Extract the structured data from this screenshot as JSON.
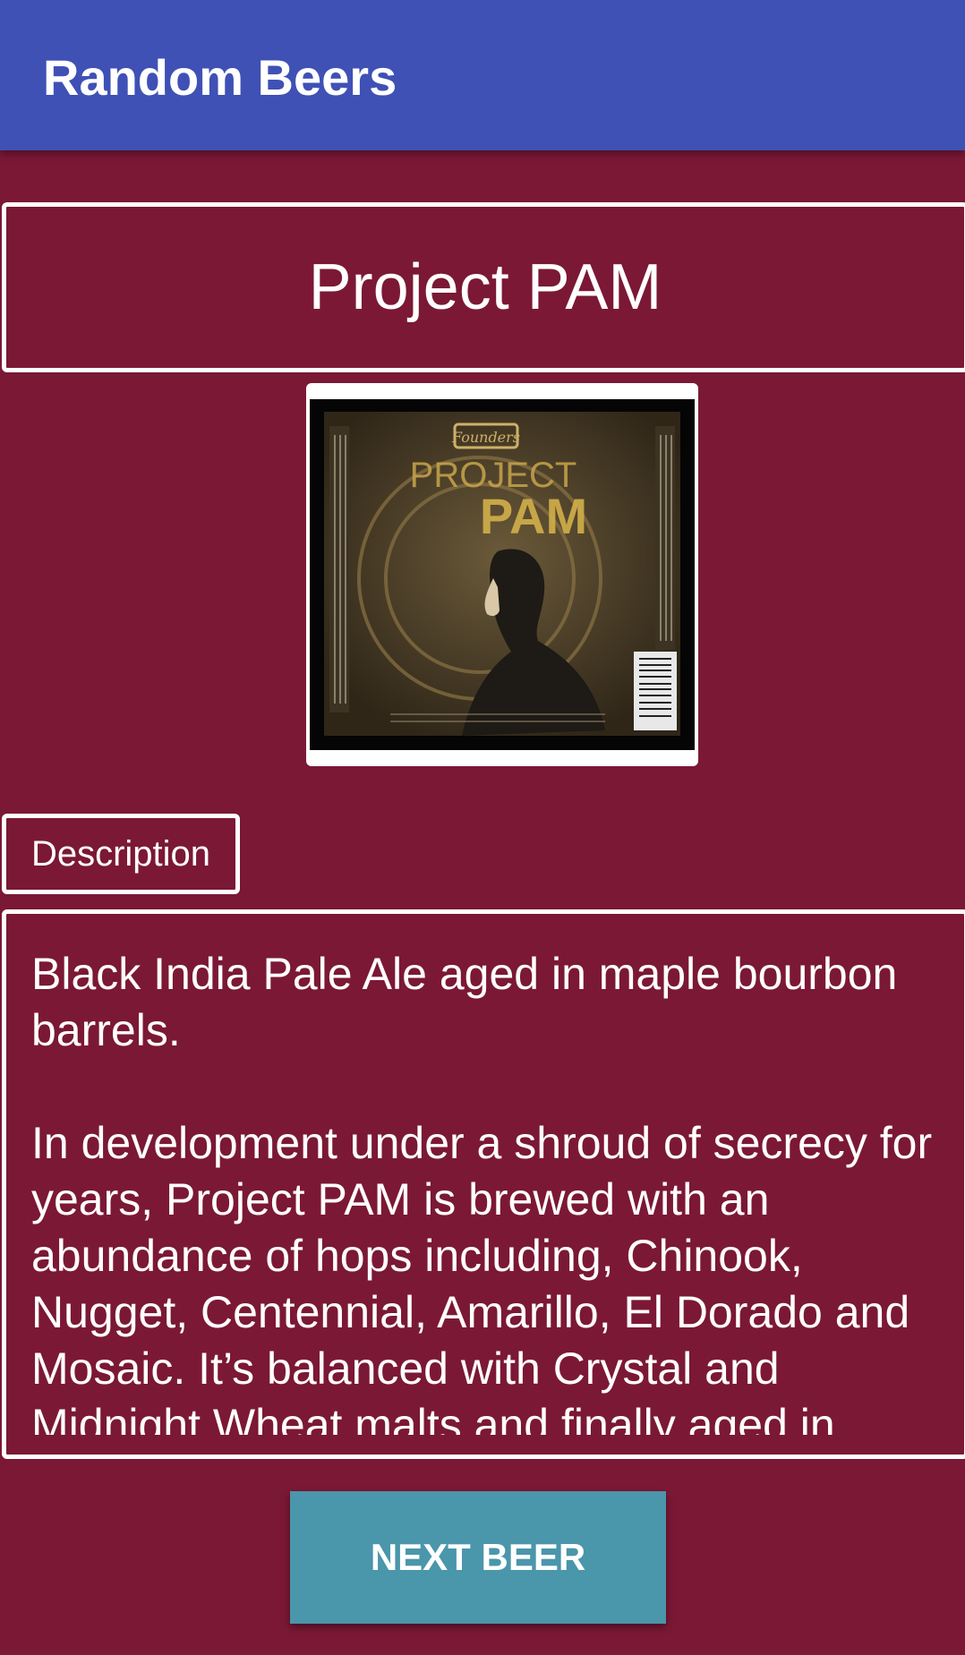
{
  "app_bar": {
    "title": "Random Beers",
    "color": "#3f51b5"
  },
  "theme": {
    "background": "#7b1835",
    "button_color": "#4a96ab"
  },
  "beer": {
    "name": "Project PAM",
    "image": {
      "label_lines": [
        "PROJECT",
        "PAM"
      ],
      "brand_mark": "Founders"
    }
  },
  "description": {
    "label": "Description",
    "text": "Black India Pale Ale aged in maple bourbon barrels.\n\nIn development under a shroud of secrecy for years, Project PAM is brewed with an abundance of hops including, Chinook, Nugget, Centennial, Amarillo, El Dorado and Mosaic. It’s balanced with Crystal and Midnight Wheat malts and finally aged in"
  },
  "actions": {
    "next_beer_label": "NEXT BEER"
  }
}
